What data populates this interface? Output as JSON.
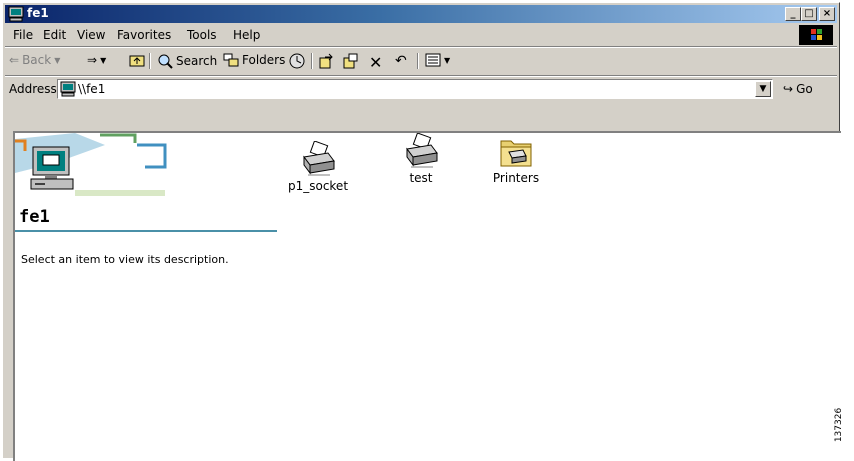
{
  "window": {
    "title": "fe1"
  },
  "menu": [
    "File",
    "Edit",
    "View",
    "Favorites",
    "Tools",
    "Help"
  ],
  "toolbar": {
    "back": "Back",
    "search": "Search",
    "folders": "Folders"
  },
  "address": {
    "label": "Address",
    "value": "\\\\fe1",
    "go": "Go"
  },
  "panel": {
    "computer_name": "fe1",
    "description": "Select an item to view its description."
  },
  "items": [
    {
      "label": "p1_socket",
      "icon": "printer-icon"
    },
    {
      "label": "test",
      "icon": "printer-icon"
    },
    {
      "label": "Printers",
      "icon": "printers-folder-icon"
    }
  ],
  "figure_id": "137326"
}
